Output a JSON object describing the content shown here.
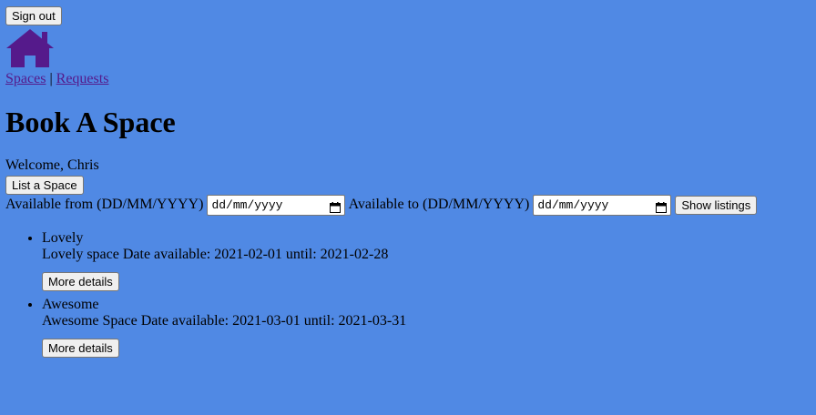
{
  "header": {
    "sign_out_label": "Sign out",
    "home_icon": "home-icon",
    "home_icon_color": "#551a8b"
  },
  "nav": {
    "spaces_label": "Spaces",
    "separator": "|",
    "requests_label": "Requests"
  },
  "page": {
    "title": "Book A Space",
    "welcome": "Welcome, Chris",
    "list_space_label": "List a Space",
    "background": "#5089e4"
  },
  "filter": {
    "from_label": "Available from (DD/MM/YYYY)",
    "from_placeholder": "dd/mm/yyyy",
    "to_label": "Available to (DD/MM/YYYY)",
    "to_placeholder": "dd/mm/yyyy",
    "show_label": "Show listings"
  },
  "listings": [
    {
      "title": "Lovely",
      "description": "Lovely space Date available: 2021-02-01 until: 2021-02-28",
      "details_label": "More details"
    },
    {
      "title": "Awesome",
      "description": "Awesome Space Date available: 2021-03-01 until: 2021-03-31",
      "details_label": "More details"
    }
  ]
}
